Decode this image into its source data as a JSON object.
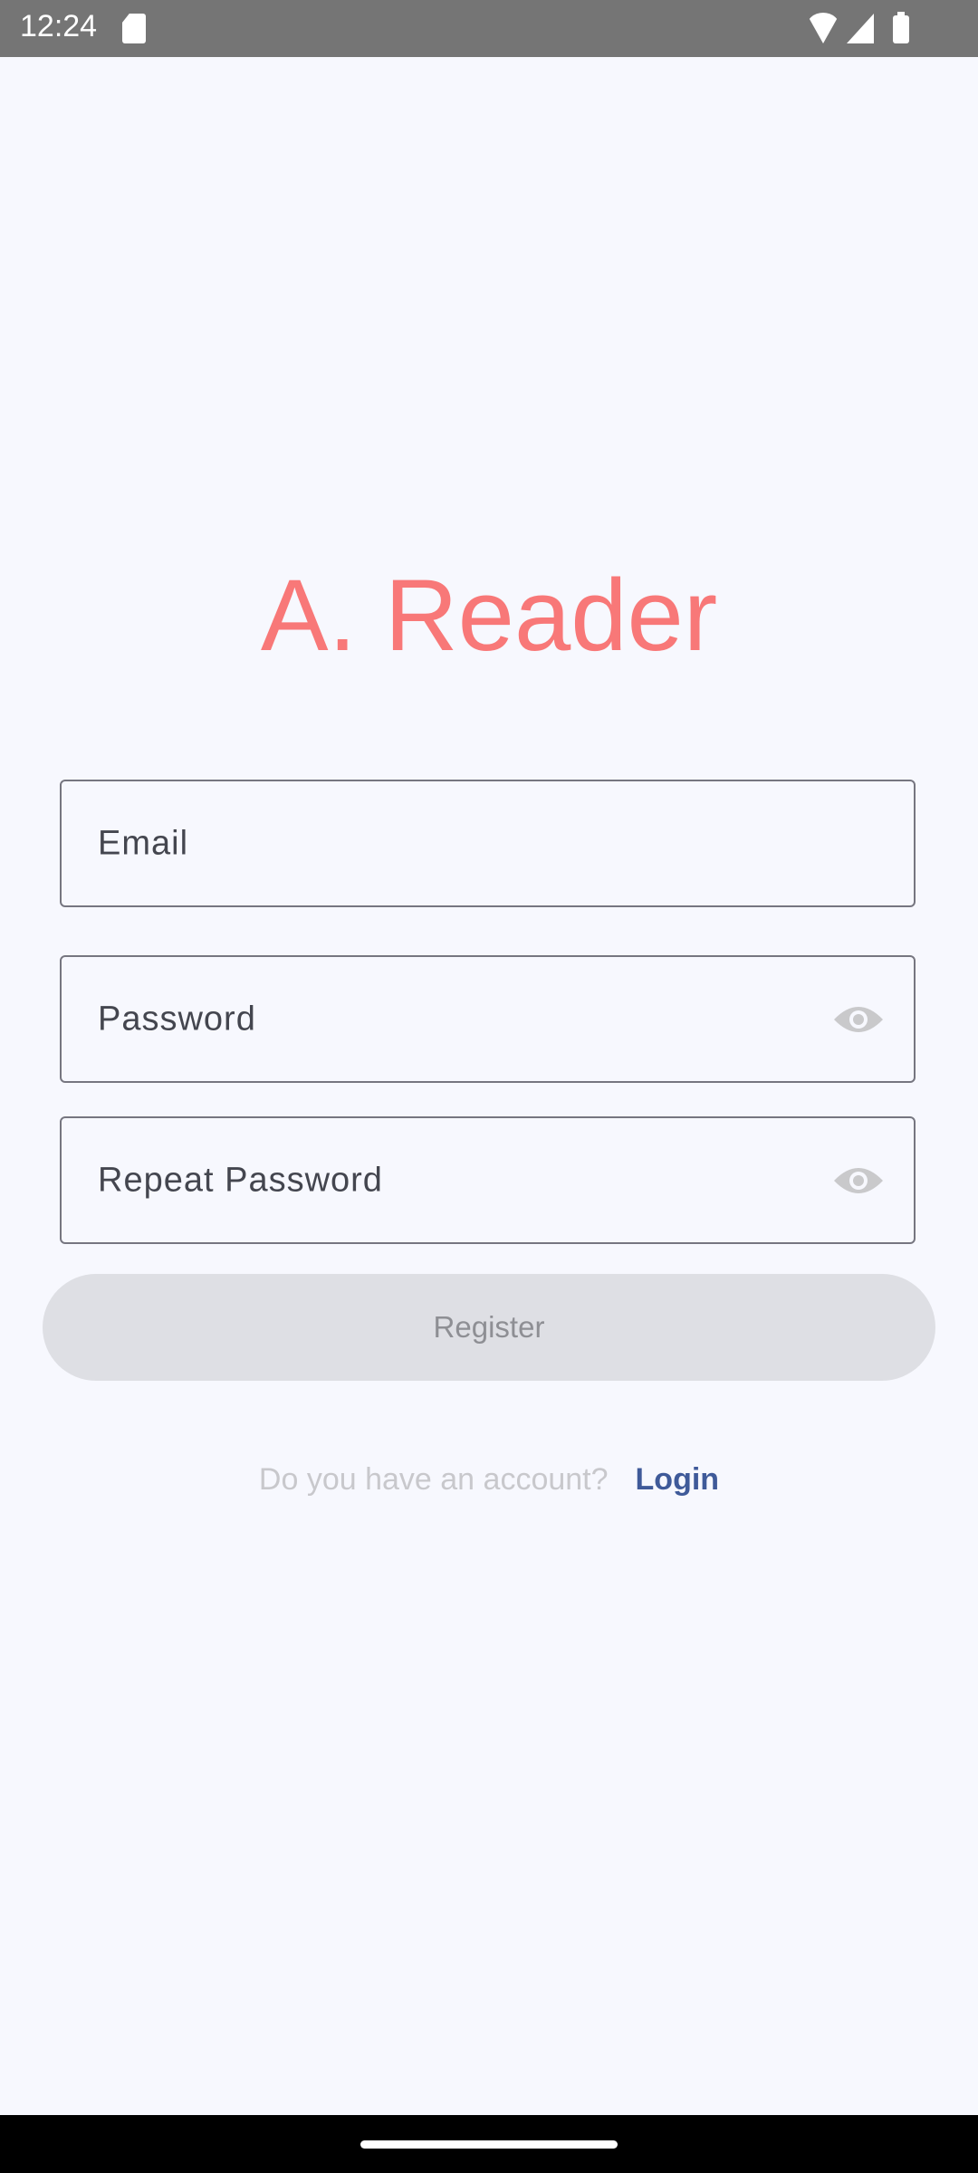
{
  "status_bar": {
    "time": "12:24"
  },
  "app_title": "A. Reader",
  "form": {
    "email_placeholder": "Email",
    "password_placeholder": "Password",
    "repeat_password_placeholder": "Repeat Password",
    "register_label": "Register"
  },
  "footer": {
    "question": "Do you have an account?",
    "login_label": "Login"
  },
  "colors": {
    "title": "#f87878",
    "link": "#3f5a99",
    "background": "#f7f8fe"
  }
}
